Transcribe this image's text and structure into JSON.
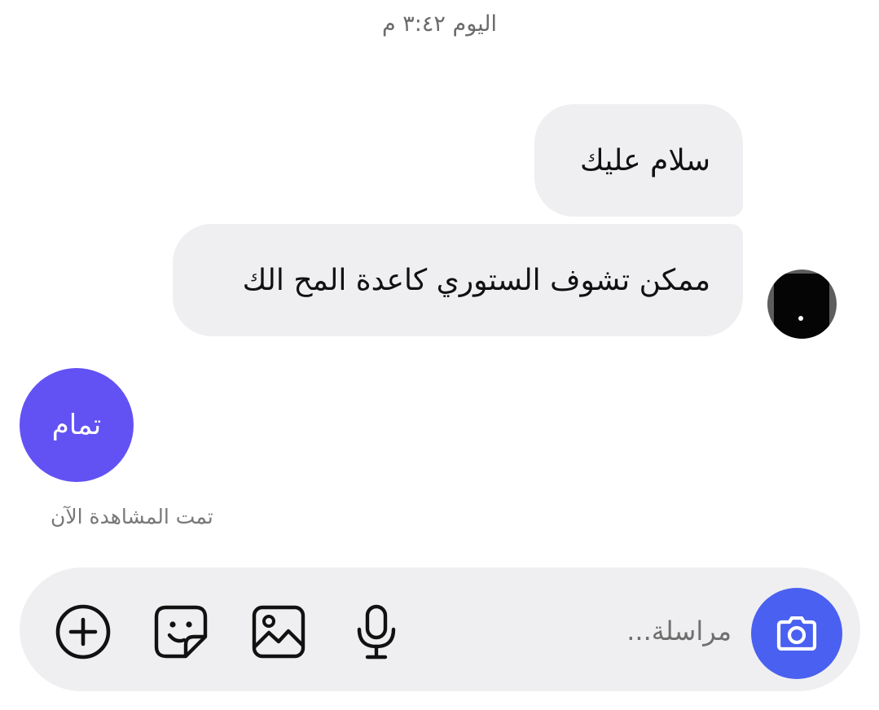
{
  "chat": {
    "timestamp": "اليوم ٣:٤٢ م",
    "messages": [
      {
        "sender": "contact",
        "text": "سلام عليك"
      },
      {
        "sender": "contact",
        "text": "ممكن تشوف الستوري كاعدة المح الك"
      },
      {
        "sender": "me",
        "text": "تمام"
      }
    ],
    "seen_status": "تمت المشاهدة الآن"
  },
  "composer": {
    "placeholder": "مراسلة...",
    "value": "",
    "icons": {
      "camera": "camera-icon",
      "mic": "microphone-icon",
      "gallery": "gallery-icon",
      "sticker": "sticker-icon",
      "plus": "plus-circle-icon"
    }
  },
  "colors": {
    "incoming_bubble": "#efeff1",
    "outgoing_bubble": "#6252f4",
    "camera_button": "#4a60f0",
    "composer_background": "#efeff1"
  }
}
